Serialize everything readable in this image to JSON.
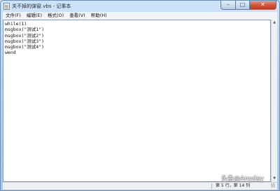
{
  "window": {
    "title": "关不掉的弹窗.vbs - 记事本",
    "controls": {
      "minimize": "–",
      "maximize": "□",
      "close": "✕"
    }
  },
  "menu": [
    "文件(F)",
    "编辑(E)",
    "格式(O)",
    "查看(V)",
    "帮助(H)"
  ],
  "editor": {
    "lines": [
      "while(1)",
      "msgbox(\"测试1\")",
      "msgbox(\"测试2\")",
      "msgbox(\"测试3\")",
      "msgbox(\"测试4\")",
      "wend"
    ]
  },
  "statusbar": {
    "position": "第 5 行，第 14 列"
  },
  "watermark": "头条@Anyday",
  "icons": {
    "app": "notepad-icon",
    "scroll_up": "scroll-up-icon",
    "scroll_down": "scroll-down-icon"
  },
  "colors": {
    "window_frame": "#a9c6e8",
    "close_button": "#c94a2f",
    "editor_bg": "#ffffff"
  }
}
